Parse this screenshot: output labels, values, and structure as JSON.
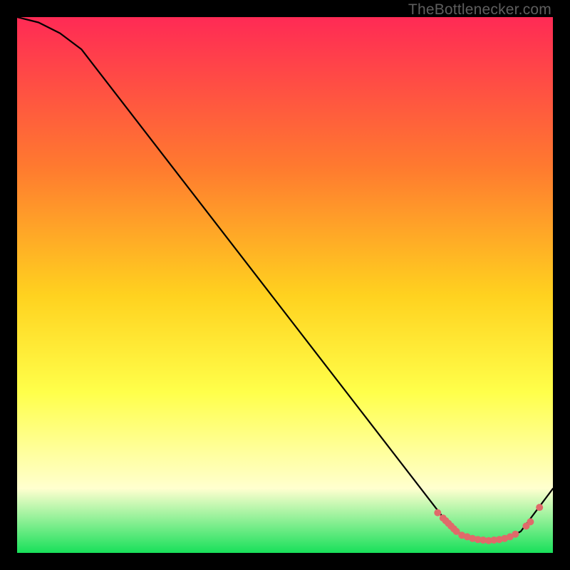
{
  "watermark": "TheBottlenecker.com",
  "colors": {
    "gradient_top": "#ff2a55",
    "gradient_mid1": "#ff7a2f",
    "gradient_mid2": "#ffd21f",
    "gradient_mid3": "#ffff4a",
    "gradient_pale": "#ffffcf",
    "gradient_bottom": "#18e05a",
    "curve": "#000000",
    "marker": "#e06a6a",
    "frame": "#000000"
  },
  "chart_data": {
    "type": "line",
    "title": "",
    "xlabel": "",
    "ylabel": "",
    "xlim": [
      0,
      100
    ],
    "ylim": [
      0,
      100
    ],
    "grid": false,
    "legend": false,
    "annotations": [],
    "series": [
      {
        "name": "bottleneck-curve",
        "x": [
          0,
          4,
          8,
          12,
          80,
          82,
          84,
          86,
          88,
          90,
          92,
          94,
          100
        ],
        "values": [
          100,
          99,
          97,
          94,
          6,
          4,
          3,
          2.5,
          2.3,
          2.5,
          3,
          4,
          12
        ]
      }
    ],
    "markers": [
      {
        "x": 78.5,
        "y": 7.5
      },
      {
        "x": 79.5,
        "y": 6.5
      },
      {
        "x": 80.0,
        "y": 6.0
      },
      {
        "x": 80.5,
        "y": 5.5
      },
      {
        "x": 81.0,
        "y": 5.0
      },
      {
        "x": 81.5,
        "y": 4.5
      },
      {
        "x": 82.0,
        "y": 4.0
      },
      {
        "x": 83.0,
        "y": 3.3
      },
      {
        "x": 84.0,
        "y": 3.0
      },
      {
        "x": 85.0,
        "y": 2.7
      },
      {
        "x": 86.0,
        "y": 2.5
      },
      {
        "x": 87.0,
        "y": 2.4
      },
      {
        "x": 88.0,
        "y": 2.3
      },
      {
        "x": 89.0,
        "y": 2.4
      },
      {
        "x": 90.0,
        "y": 2.5
      },
      {
        "x": 91.0,
        "y": 2.7
      },
      {
        "x": 92.0,
        "y": 3.0
      },
      {
        "x": 93.0,
        "y": 3.5
      },
      {
        "x": 95.0,
        "y": 5.0
      },
      {
        "x": 95.8,
        "y": 5.8
      },
      {
        "x": 97.5,
        "y": 8.5
      }
    ]
  }
}
